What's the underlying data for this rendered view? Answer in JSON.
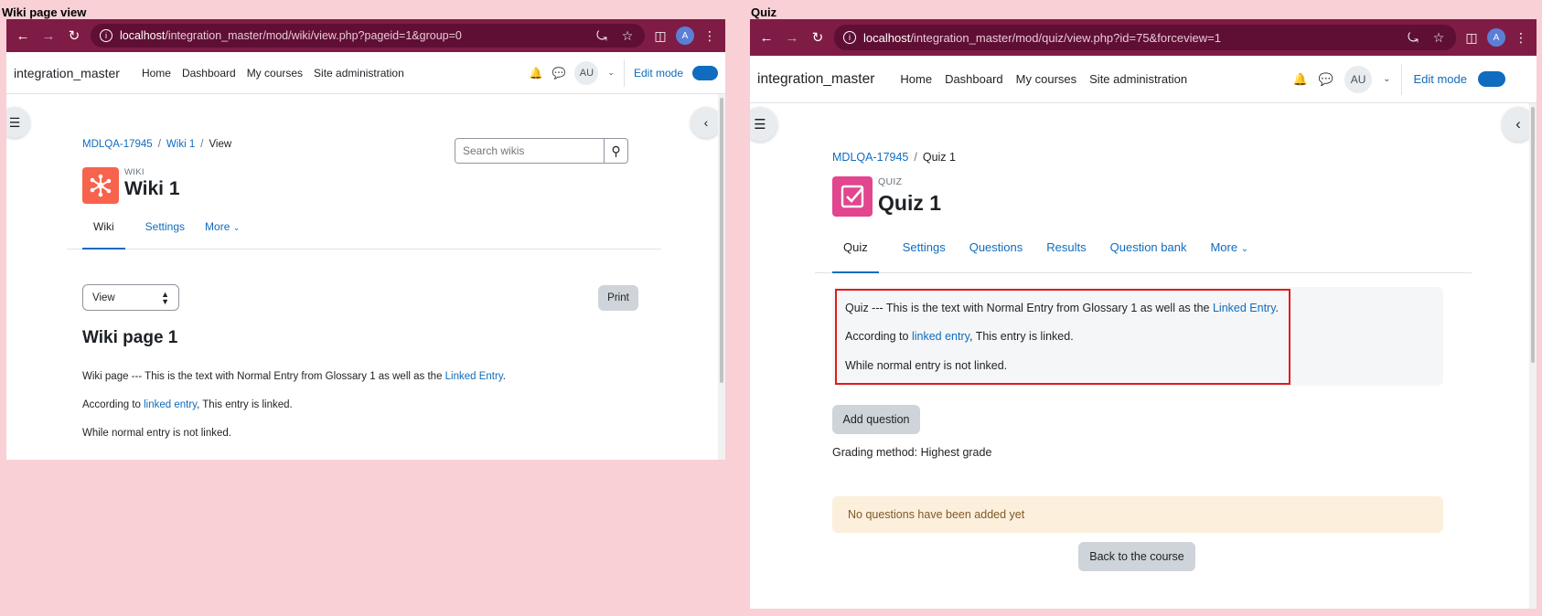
{
  "labels": {
    "left_panel": "Wiki page view",
    "right_panel": "Quiz"
  },
  "left": {
    "url_host": "localhost",
    "url_rest": "/integration_master/mod/wiki/view.php?pageid=1&group=0",
    "profile_initial": "A",
    "brand": "integration_master",
    "nav": [
      "Home",
      "Dashboard",
      "My courses",
      "Site administration"
    ],
    "avatar": "AU",
    "edit_mode": "Edit mode",
    "breadcrumb": [
      "MDLQA-17945",
      "Wiki 1",
      "View"
    ],
    "search_placeholder": "Search wikis",
    "activity_type": "WIKI",
    "activity_title": "Wiki 1",
    "tabs": [
      "Wiki",
      "Settings",
      "More"
    ],
    "view_select": "View",
    "print": "Print",
    "page_heading": "Wiki page 1",
    "p1_text": "Wiki page --- This is the text with Normal Entry from Glossary 1 as well as the ",
    "p1_link": "Linked Entry",
    "p1_end": ".",
    "p2_text": "According to ",
    "p2_link": "linked entry",
    "p2_end": ", This entry is linked.",
    "p3": "While normal entry is not linked."
  },
  "right": {
    "url_host": "localhost",
    "url_rest": "/integration_master/mod/quiz/view.php?id=75&forceview=1",
    "profile_initial": "A",
    "brand": "integration_master",
    "nav": [
      "Home",
      "Dashboard",
      "My courses",
      "Site administration"
    ],
    "avatar": "AU",
    "edit_mode": "Edit mode",
    "breadcrumb": [
      "MDLQA-17945",
      "Quiz 1"
    ],
    "activity_type": "QUIZ",
    "activity_title": "Quiz 1",
    "tabs": [
      "Quiz",
      "Settings",
      "Questions",
      "Results",
      "Question bank",
      "More"
    ],
    "p1_text": "Quiz --- This is the text with Normal Entry from Glossary 1 as well as the ",
    "p1_link": "Linked Entry",
    "p1_end": ".",
    "p2_text": "According to ",
    "p2_link": "linked entry",
    "p2_end": ", This entry is linked.",
    "p3": "While normal entry is not linked.",
    "add_question": "Add question",
    "grading": "Grading method: Highest grade",
    "no_questions": "No questions have been added yet",
    "back": "Back to the course"
  },
  "colors": {
    "chrome": "#7e1c45",
    "link": "#0f6cbf",
    "wiki_icon": "#f7634d",
    "quiz_icon": "#e1468e",
    "highlight": "#e21b1b",
    "notice_bg": "#fcefdc"
  }
}
